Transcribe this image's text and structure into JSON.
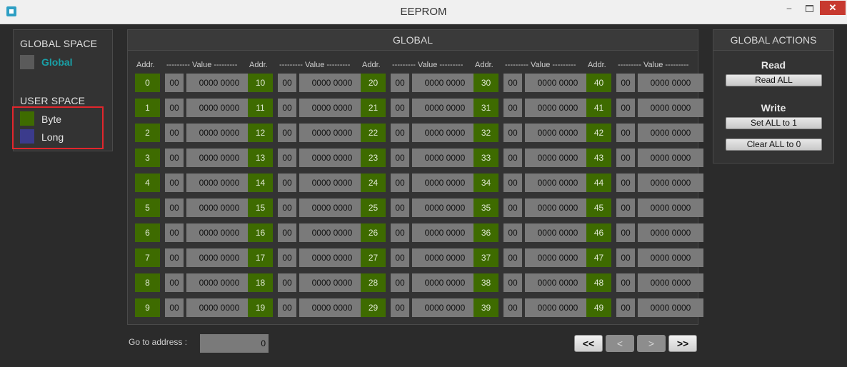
{
  "window": {
    "title": "EEPROM",
    "min": "–",
    "close": "✕"
  },
  "sidebar": {
    "global_space_title": "GLOBAL SPACE",
    "global_item": {
      "label": "Global",
      "color": "#5a5a5a",
      "text_color": "#19a0a7"
    },
    "user_space_title": "USER SPACE",
    "user_items": [
      {
        "label": "Byte",
        "color": "#3e6b00"
      },
      {
        "label": "Long",
        "color": "#3b3b8c"
      }
    ]
  },
  "global": {
    "title": "GLOBAL",
    "addr_header": "Addr.",
    "value_header": "--------- Value ---------",
    "columns": [
      {
        "rows": [
          {
            "addr": "0",
            "byte": "00",
            "bits": "0000 0000"
          },
          {
            "addr": "1",
            "byte": "00",
            "bits": "0000 0000"
          },
          {
            "addr": "2",
            "byte": "00",
            "bits": "0000 0000"
          },
          {
            "addr": "3",
            "byte": "00",
            "bits": "0000 0000"
          },
          {
            "addr": "4",
            "byte": "00",
            "bits": "0000 0000"
          },
          {
            "addr": "5",
            "byte": "00",
            "bits": "0000 0000"
          },
          {
            "addr": "6",
            "byte": "00",
            "bits": "0000 0000"
          },
          {
            "addr": "7",
            "byte": "00",
            "bits": "0000 0000"
          },
          {
            "addr": "8",
            "byte": "00",
            "bits": "0000 0000"
          },
          {
            "addr": "9",
            "byte": "00",
            "bits": "0000 0000"
          }
        ]
      },
      {
        "rows": [
          {
            "addr": "10",
            "byte": "00",
            "bits": "0000 0000"
          },
          {
            "addr": "11",
            "byte": "00",
            "bits": "0000 0000"
          },
          {
            "addr": "12",
            "byte": "00",
            "bits": "0000 0000"
          },
          {
            "addr": "13",
            "byte": "00",
            "bits": "0000 0000"
          },
          {
            "addr": "14",
            "byte": "00",
            "bits": "0000 0000"
          },
          {
            "addr": "15",
            "byte": "00",
            "bits": "0000 0000"
          },
          {
            "addr": "16",
            "byte": "00",
            "bits": "0000 0000"
          },
          {
            "addr": "17",
            "byte": "00",
            "bits": "0000 0000"
          },
          {
            "addr": "18",
            "byte": "00",
            "bits": "0000 0000"
          },
          {
            "addr": "19",
            "byte": "00",
            "bits": "0000 0000"
          }
        ]
      },
      {
        "rows": [
          {
            "addr": "20",
            "byte": "00",
            "bits": "0000 0000"
          },
          {
            "addr": "21",
            "byte": "00",
            "bits": "0000 0000"
          },
          {
            "addr": "22",
            "byte": "00",
            "bits": "0000 0000"
          },
          {
            "addr": "23",
            "byte": "00",
            "bits": "0000 0000"
          },
          {
            "addr": "24",
            "byte": "00",
            "bits": "0000 0000"
          },
          {
            "addr": "25",
            "byte": "00",
            "bits": "0000 0000"
          },
          {
            "addr": "26",
            "byte": "00",
            "bits": "0000 0000"
          },
          {
            "addr": "27",
            "byte": "00",
            "bits": "0000 0000"
          },
          {
            "addr": "28",
            "byte": "00",
            "bits": "0000 0000"
          },
          {
            "addr": "29",
            "byte": "00",
            "bits": "0000 0000"
          }
        ]
      },
      {
        "rows": [
          {
            "addr": "30",
            "byte": "00",
            "bits": "0000 0000"
          },
          {
            "addr": "31",
            "byte": "00",
            "bits": "0000 0000"
          },
          {
            "addr": "32",
            "byte": "00",
            "bits": "0000 0000"
          },
          {
            "addr": "33",
            "byte": "00",
            "bits": "0000 0000"
          },
          {
            "addr": "34",
            "byte": "00",
            "bits": "0000 0000"
          },
          {
            "addr": "35",
            "byte": "00",
            "bits": "0000 0000"
          },
          {
            "addr": "36",
            "byte": "00",
            "bits": "0000 0000"
          },
          {
            "addr": "37",
            "byte": "00",
            "bits": "0000 0000"
          },
          {
            "addr": "38",
            "byte": "00",
            "bits": "0000 0000"
          },
          {
            "addr": "39",
            "byte": "00",
            "bits": "0000 0000"
          }
        ]
      },
      {
        "rows": [
          {
            "addr": "40",
            "byte": "00",
            "bits": "0000 0000"
          },
          {
            "addr": "41",
            "byte": "00",
            "bits": "0000 0000"
          },
          {
            "addr": "42",
            "byte": "00",
            "bits": "0000 0000"
          },
          {
            "addr": "43",
            "byte": "00",
            "bits": "0000 0000"
          },
          {
            "addr": "44",
            "byte": "00",
            "bits": "0000 0000"
          },
          {
            "addr": "45",
            "byte": "00",
            "bits": "0000 0000"
          },
          {
            "addr": "46",
            "byte": "00",
            "bits": "0000 0000"
          },
          {
            "addr": "47",
            "byte": "00",
            "bits": "0000 0000"
          },
          {
            "addr": "48",
            "byte": "00",
            "bits": "0000 0000"
          },
          {
            "addr": "49",
            "byte": "00",
            "bits": "0000 0000"
          }
        ]
      }
    ]
  },
  "actions": {
    "title": "GLOBAL ACTIONS",
    "read_label": "Read",
    "read_all": "Read ALL",
    "write_label": "Write",
    "set_all": "Set ALL to 1",
    "clear_all": "Clear ALL to 0"
  },
  "navigation": {
    "goto_label": "Go to address :",
    "goto_value": "0",
    "first": "<<",
    "prev": "<",
    "next": ">",
    "last": ">>"
  }
}
